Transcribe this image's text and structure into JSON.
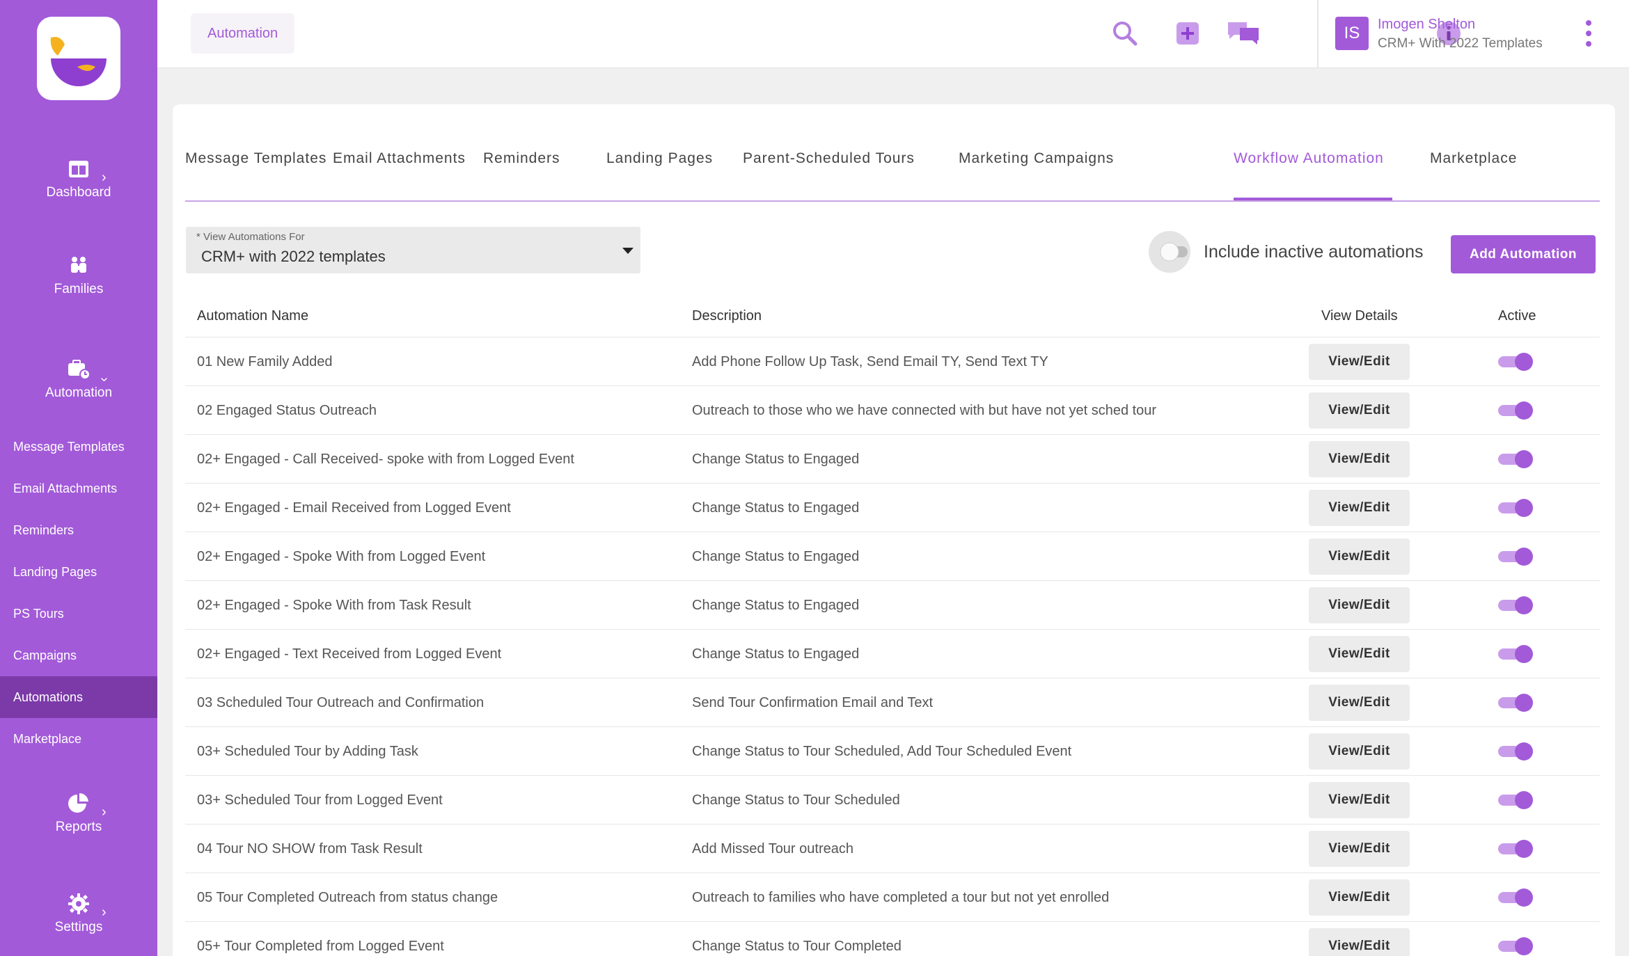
{
  "header": {
    "breadcrumb": "Automation",
    "user_initials": "IS",
    "user_name": "Imogen Shelton",
    "user_org": "CRM+ With 2022 Templates"
  },
  "sidebar": {
    "groups": [
      {
        "label": "Dashboard",
        "icon": "dashboard-icon"
      },
      {
        "label": "Families",
        "icon": "families-icon"
      },
      {
        "label": "Automation",
        "icon": "automation-icon"
      },
      {
        "label": "Reports",
        "icon": "reports-icon"
      },
      {
        "label": "Settings",
        "icon": "settings-icon"
      }
    ],
    "sub_items": [
      {
        "label": "Message Templates"
      },
      {
        "label": "Email Attachments"
      },
      {
        "label": "Reminders"
      },
      {
        "label": "Landing Pages"
      },
      {
        "label": "PS Tours"
      },
      {
        "label": "Campaigns"
      },
      {
        "label": "Automations",
        "active": true
      },
      {
        "label": "Marketplace"
      }
    ]
  },
  "tabs": [
    "Message Templates",
    "Email Attachments",
    "Reminders",
    "Landing Pages",
    "Parent-Scheduled Tours",
    "Marketing Campaigns",
    "Workflow Automation",
    "Marketplace"
  ],
  "active_tab": "Workflow Automation",
  "filter": {
    "label": "* View Automations For",
    "value": "CRM+ with 2022 templates"
  },
  "include_inactive": {
    "label": "Include inactive automations",
    "checked": false
  },
  "add_button": "Add Automation",
  "table": {
    "headers": {
      "name": "Automation Name",
      "description": "Description",
      "view": "View Details",
      "active": "Active"
    },
    "view_label": "View/Edit",
    "rows": [
      {
        "name": "01 New Family Added",
        "description": "Add Phone Follow Up Task, Send Email TY, Send Text TY",
        "active": true
      },
      {
        "name": "02 Engaged Status Outreach",
        "description": "Outreach to those who we have connected with but have not yet sched tour",
        "active": true
      },
      {
        "name": "02+ Engaged - Call Received- spoke with from Logged Event",
        "description": "Change Status to Engaged",
        "active": true
      },
      {
        "name": "02+ Engaged - Email Received from Logged Event",
        "description": "Change Status to Engaged",
        "active": true
      },
      {
        "name": "02+ Engaged - Spoke With from Logged Event",
        "description": "Change Status to Engaged",
        "active": true
      },
      {
        "name": "02+ Engaged - Spoke With from Task Result",
        "description": "Change Status to Engaged",
        "active": true
      },
      {
        "name": "02+ Engaged - Text Received from Logged Event",
        "description": "Change Status to Engaged",
        "active": true
      },
      {
        "name": "03 Scheduled Tour Outreach and Confirmation",
        "description": "Send Tour Confirmation Email and Text",
        "active": true
      },
      {
        "name": "03+ Scheduled Tour by Adding Task",
        "description": "Change Status to Tour Scheduled, Add Tour Scheduled Event",
        "active": true
      },
      {
        "name": "03+ Scheduled Tour from Logged Event",
        "description": "Change Status to Tour Scheduled",
        "active": true
      },
      {
        "name": "04 Tour NO SHOW from Task Result",
        "description": "Add Missed Tour outreach",
        "active": true
      },
      {
        "name": "05 Tour Completed Outreach from status change",
        "description": "Outreach to families who have completed a tour but not yet enrolled",
        "active": true
      },
      {
        "name": "05+ Tour Completed from Logged Event",
        "description": "Change Status to Tour Completed",
        "active": true
      }
    ]
  },
  "colors": {
    "brand": "#a25ad9",
    "brand_dark": "#7b3aa8",
    "logo_yellow": "#f5b21f"
  }
}
